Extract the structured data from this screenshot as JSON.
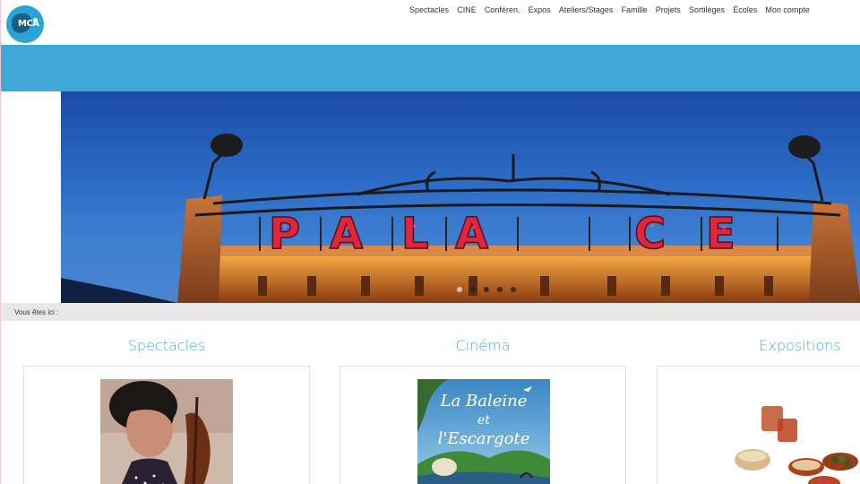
{
  "logo": {
    "text": "MCA"
  },
  "nav": {
    "items": [
      {
        "label": "Spectacles"
      },
      {
        "label": "CINE"
      },
      {
        "label": "Conféren."
      },
      {
        "label": "Expos"
      },
      {
        "label": "Ateliers/Stages"
      },
      {
        "label": "Famille"
      },
      {
        "label": "Projets"
      },
      {
        "label": "Sortilèges"
      },
      {
        "label": "Écoles"
      },
      {
        "label": "Mon compte"
      }
    ]
  },
  "hero": {
    "sign_letters": [
      "P",
      "A",
      "L",
      "A",
      "C",
      "E"
    ],
    "slide_count": 5,
    "active_slide": 1
  },
  "breadcrumb": {
    "label": "Vous êtes ici :"
  },
  "sections": [
    {
      "title": "Spectacles"
    },
    {
      "title": "Cinéma",
      "poster_title_line1": "La Baleine",
      "poster_title_line2": "et",
      "poster_title_line3": "l'Escargote"
    },
    {
      "title": "Expositions"
    }
  ],
  "colors": {
    "accent": "#3fa8d8",
    "title_blue": "#4aa8d8",
    "neon_red": "#e0263d"
  }
}
